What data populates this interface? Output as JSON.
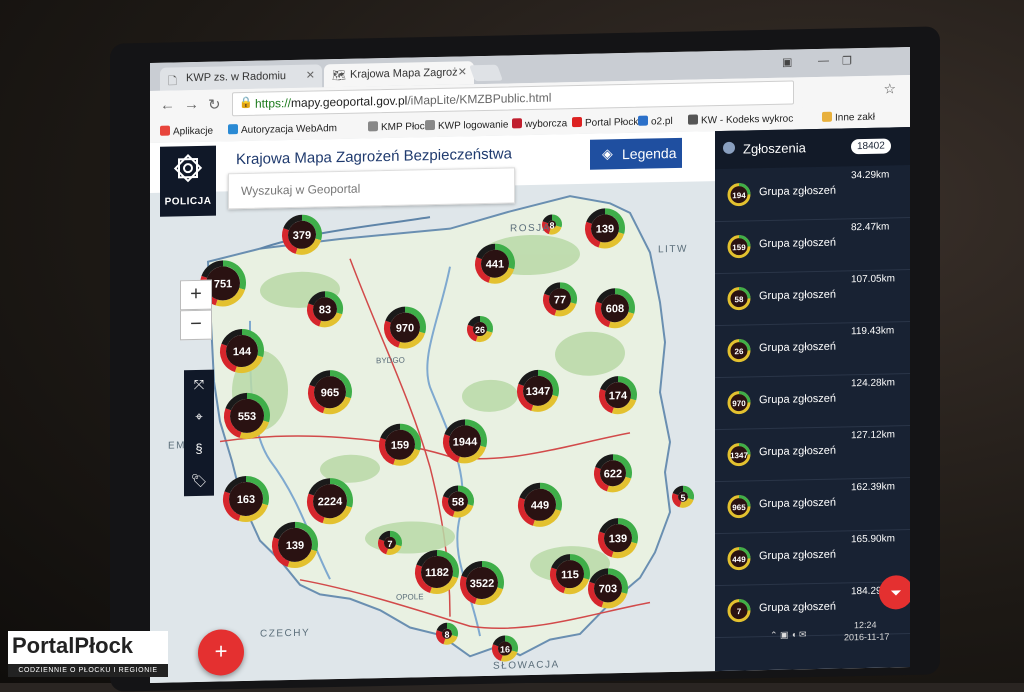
{
  "browser": {
    "tabs": [
      {
        "label": "KWP zs. w Radomiu"
      },
      {
        "label": "Krajowa Mapa Zagroż"
      }
    ],
    "url": {
      "scheme": "https://",
      "host": "mapy.geoportal.gov.pl",
      "path": "/iMapLite/KMZBPublic.html"
    },
    "bookmarks": [
      {
        "label": "Aplikacje",
        "color": "#e8453c"
      },
      {
        "label": "Autoryzacja WebAdm",
        "color": "#2a8ad4"
      },
      {
        "label": "KMP Płock",
        "color": "#888888"
      },
      {
        "label": "KWP logowanie",
        "color": "#888888"
      },
      {
        "label": "wyborcza",
        "color": "#c01f2e"
      },
      {
        "label": "Portal Płock",
        "color": "#d22"
      },
      {
        "label": "o2.pl",
        "color": "#2b70c9"
      },
      {
        "label": "KW - Kodeks wykroc",
        "color": "#555555"
      },
      {
        "label": "Inne zakł",
        "color": "#e8b03c"
      }
    ]
  },
  "app": {
    "logo_text": "POLICJA",
    "title": "Krajowa Mapa Zagrożeń Bezpieczeństwa",
    "search_placeholder": "Wyszukaj w Geoportal",
    "legend_label": "Legenda",
    "zoom_in": "+",
    "zoom_out": "−",
    "tools": [
      "⤧",
      "⌖",
      "§",
      "🏷"
    ],
    "fab_label": "+",
    "map_labels": {
      "rosja": "ROSJA",
      "litwa": "LITW",
      "czechy": "CZECHY",
      "slowacja": "SŁOWACJA",
      "niemcy": "EM",
      "bydgoszcz": "BYDGO",
      "opole": "OPOLE"
    }
  },
  "clusters": [
    {
      "count": "379"
    },
    {
      "count": "8"
    },
    {
      "count": "139"
    },
    {
      "count": "751"
    },
    {
      "count": "441"
    },
    {
      "count": "83"
    },
    {
      "count": "77"
    },
    {
      "count": "608"
    },
    {
      "count": "970"
    },
    {
      "count": "144"
    },
    {
      "count": "26"
    },
    {
      "count": "965"
    },
    {
      "count": "1347"
    },
    {
      "count": "174"
    },
    {
      "count": "553"
    },
    {
      "count": "159"
    },
    {
      "count": "1944"
    },
    {
      "count": "622"
    },
    {
      "count": "163"
    },
    {
      "count": "2224"
    },
    {
      "count": "58"
    },
    {
      "count": "449"
    },
    {
      "count": "5"
    },
    {
      "count": "139"
    },
    {
      "count": "7"
    },
    {
      "count": "139"
    },
    {
      "count": "1182"
    },
    {
      "count": "3522"
    },
    {
      "count": "115"
    },
    {
      "count": "703"
    },
    {
      "count": "8"
    },
    {
      "count": "16"
    }
  ],
  "panel": {
    "title": "Zgłoszenia",
    "count": "18402",
    "items": [
      {
        "count": "194",
        "name": "Grupa zgłoszeń",
        "distance": "34.29km"
      },
      {
        "count": "159",
        "name": "Grupa zgłoszeń",
        "distance": "82.47km"
      },
      {
        "count": "58",
        "name": "Grupa zgłoszeń",
        "distance": "107.05km"
      },
      {
        "count": "26",
        "name": "Grupa zgłoszeń",
        "distance": "119.43km"
      },
      {
        "count": "970",
        "name": "Grupa zgłoszeń",
        "distance": "124.28km"
      },
      {
        "count": "1347",
        "name": "Grupa zgłoszeń",
        "distance": "127.12km"
      },
      {
        "count": "965",
        "name": "Grupa zgłoszeń",
        "distance": "162.39km"
      },
      {
        "count": "449",
        "name": "Grupa zgłoszeń",
        "distance": "165.90km"
      },
      {
        "count": "7",
        "name": "Grupa zgłoszeń",
        "distance": "184.29km"
      }
    ],
    "filter_icon": "filter-icon"
  },
  "taskbar": {
    "time": "12:24",
    "date": "2016-11-17"
  },
  "watermark": {
    "brand": "PortalPłock",
    "tagline": "CODZIENNIE O PŁOCKU I REGIONIE"
  },
  "colors": {
    "ring_green": "#3fae49",
    "ring_yellow": "#e3c12f",
    "ring_red": "#d6262c",
    "ring_black": "#1a1a1a",
    "brand_blue": "#1f4fa0",
    "panel_bg": "#182233"
  }
}
